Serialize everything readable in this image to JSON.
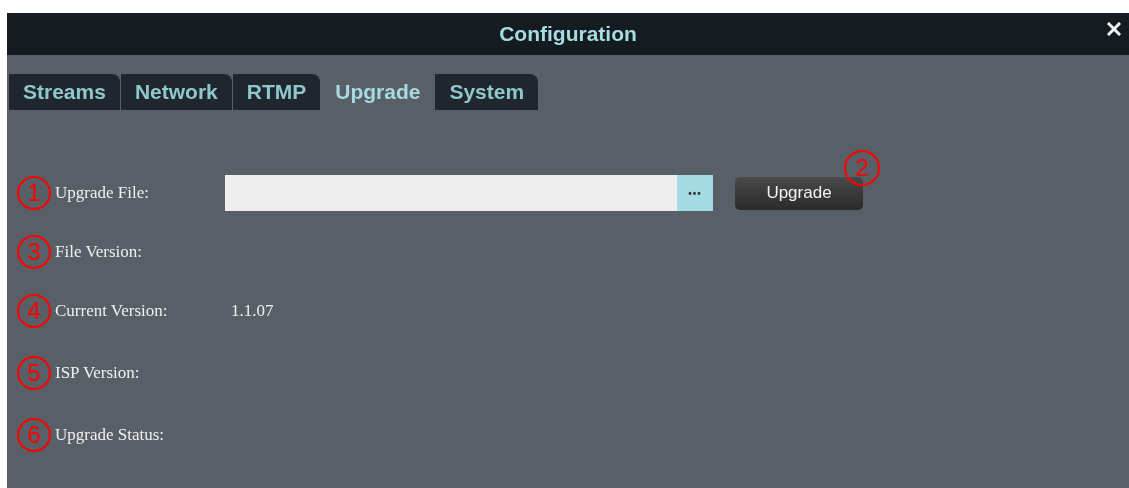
{
  "window": {
    "title": "Configuration"
  },
  "tabs": [
    {
      "label": "Streams",
      "selected": false
    },
    {
      "label": "Network",
      "selected": false
    },
    {
      "label": "RTMP",
      "selected": false
    },
    {
      "label": "Upgrade",
      "selected": true
    },
    {
      "label": "System",
      "selected": false
    }
  ],
  "rows": [
    {
      "kind": "file",
      "marker": "1",
      "label": "Upgrade File:",
      "browse": "•••",
      "button": {
        "label": "Upgrade",
        "marker": "2"
      }
    },
    {
      "kind": "text",
      "marker": "3",
      "label": "File Version:"
    },
    {
      "kind": "text",
      "marker": "4",
      "label": "Current Version:",
      "value": "1.1.07"
    },
    {
      "kind": "text",
      "marker": "5",
      "label": "ISP Version:"
    },
    {
      "kind": "text",
      "marker": "6",
      "label": "Upgrade Status:"
    }
  ]
}
